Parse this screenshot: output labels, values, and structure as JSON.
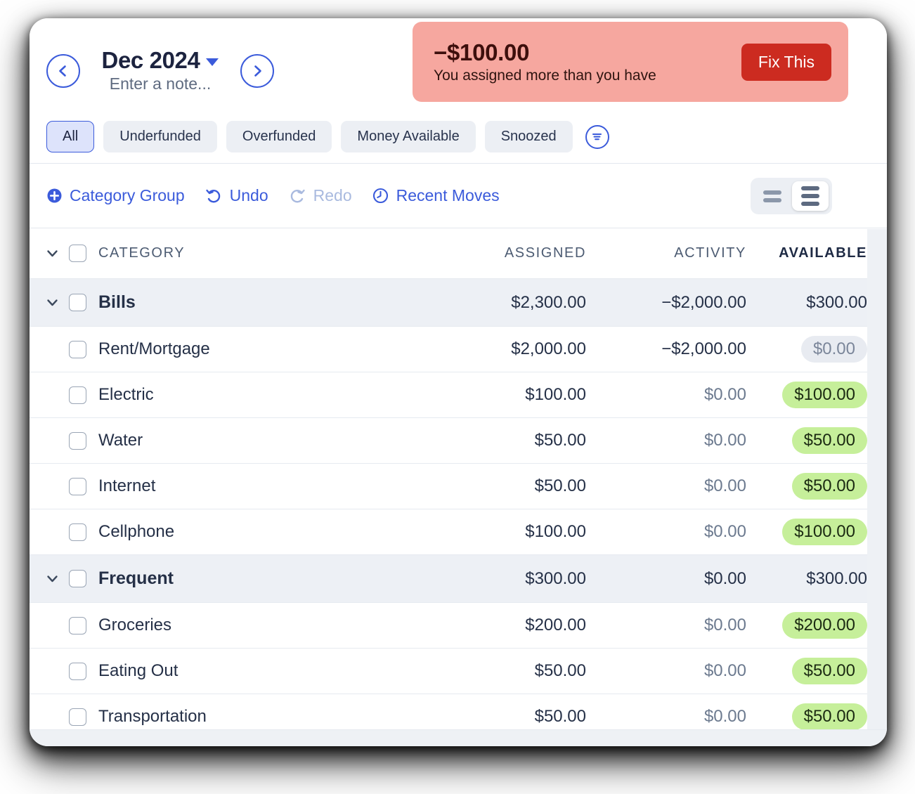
{
  "header": {
    "month": "Dec 2024",
    "note_placeholder": "Enter a note...",
    "prev_icon": "chevron-left-icon",
    "next_icon": "chevron-right-icon",
    "dropdown_icon": "caret-down-icon"
  },
  "alert": {
    "amount": "−$100.00",
    "message": "You assigned more than you have",
    "button_label": "Fix This",
    "bg_color": "#f6a79f",
    "button_color": "#cc2b20"
  },
  "filters": {
    "pills": [
      {
        "label": "All",
        "active": true
      },
      {
        "label": "Underfunded",
        "active": false
      },
      {
        "label": "Overfunded",
        "active": false
      },
      {
        "label": "Money Available",
        "active": false
      },
      {
        "label": "Snoozed",
        "active": false
      }
    ],
    "filter_icon": "filter-icon"
  },
  "toolbar": {
    "category_group_label": "Category Group",
    "undo_label": "Undo",
    "redo_label": "Redo",
    "recent_moves_label": "Recent Moves",
    "redo_disabled": true,
    "view_modes": [
      {
        "name": "compact-view",
        "active": false
      },
      {
        "name": "expanded-view",
        "active": true
      }
    ]
  },
  "table": {
    "columns": {
      "category": "CATEGORY",
      "assigned": "ASSIGNED",
      "activity": "ACTIVITY",
      "available": "AVAILABLE"
    },
    "rows": [
      {
        "type": "group",
        "name": "Bills",
        "assigned": "$2,300.00",
        "activity": "−$2,000.00",
        "available": "$300.00",
        "available_style": "plain"
      },
      {
        "type": "item",
        "name": "Rent/Mortgage",
        "assigned": "$2,000.00",
        "activity": "−$2,000.00",
        "available": "$0.00",
        "available_style": "gray"
      },
      {
        "type": "item",
        "name": "Electric",
        "assigned": "$100.00",
        "activity": "$0.00",
        "available": "$100.00",
        "available_style": "green"
      },
      {
        "type": "item",
        "name": "Water",
        "assigned": "$50.00",
        "activity": "$0.00",
        "available": "$50.00",
        "available_style": "green"
      },
      {
        "type": "item",
        "name": "Internet",
        "assigned": "$50.00",
        "activity": "$0.00",
        "available": "$50.00",
        "available_style": "green"
      },
      {
        "type": "item",
        "name": "Cellphone",
        "assigned": "$100.00",
        "activity": "$0.00",
        "available": "$100.00",
        "available_style": "green"
      },
      {
        "type": "group",
        "name": "Frequent",
        "assigned": "$300.00",
        "activity": "$0.00",
        "available": "$300.00",
        "available_style": "plain"
      },
      {
        "type": "item",
        "name": "Groceries",
        "assigned": "$200.00",
        "activity": "$0.00",
        "available": "$200.00",
        "available_style": "green"
      },
      {
        "type": "item",
        "name": "Eating Out",
        "assigned": "$50.00",
        "activity": "$0.00",
        "available": "$50.00",
        "available_style": "green"
      },
      {
        "type": "item",
        "name": "Transportation",
        "assigned": "$50.00",
        "activity": "$0.00",
        "available": "$50.00",
        "available_style": "green"
      }
    ]
  }
}
